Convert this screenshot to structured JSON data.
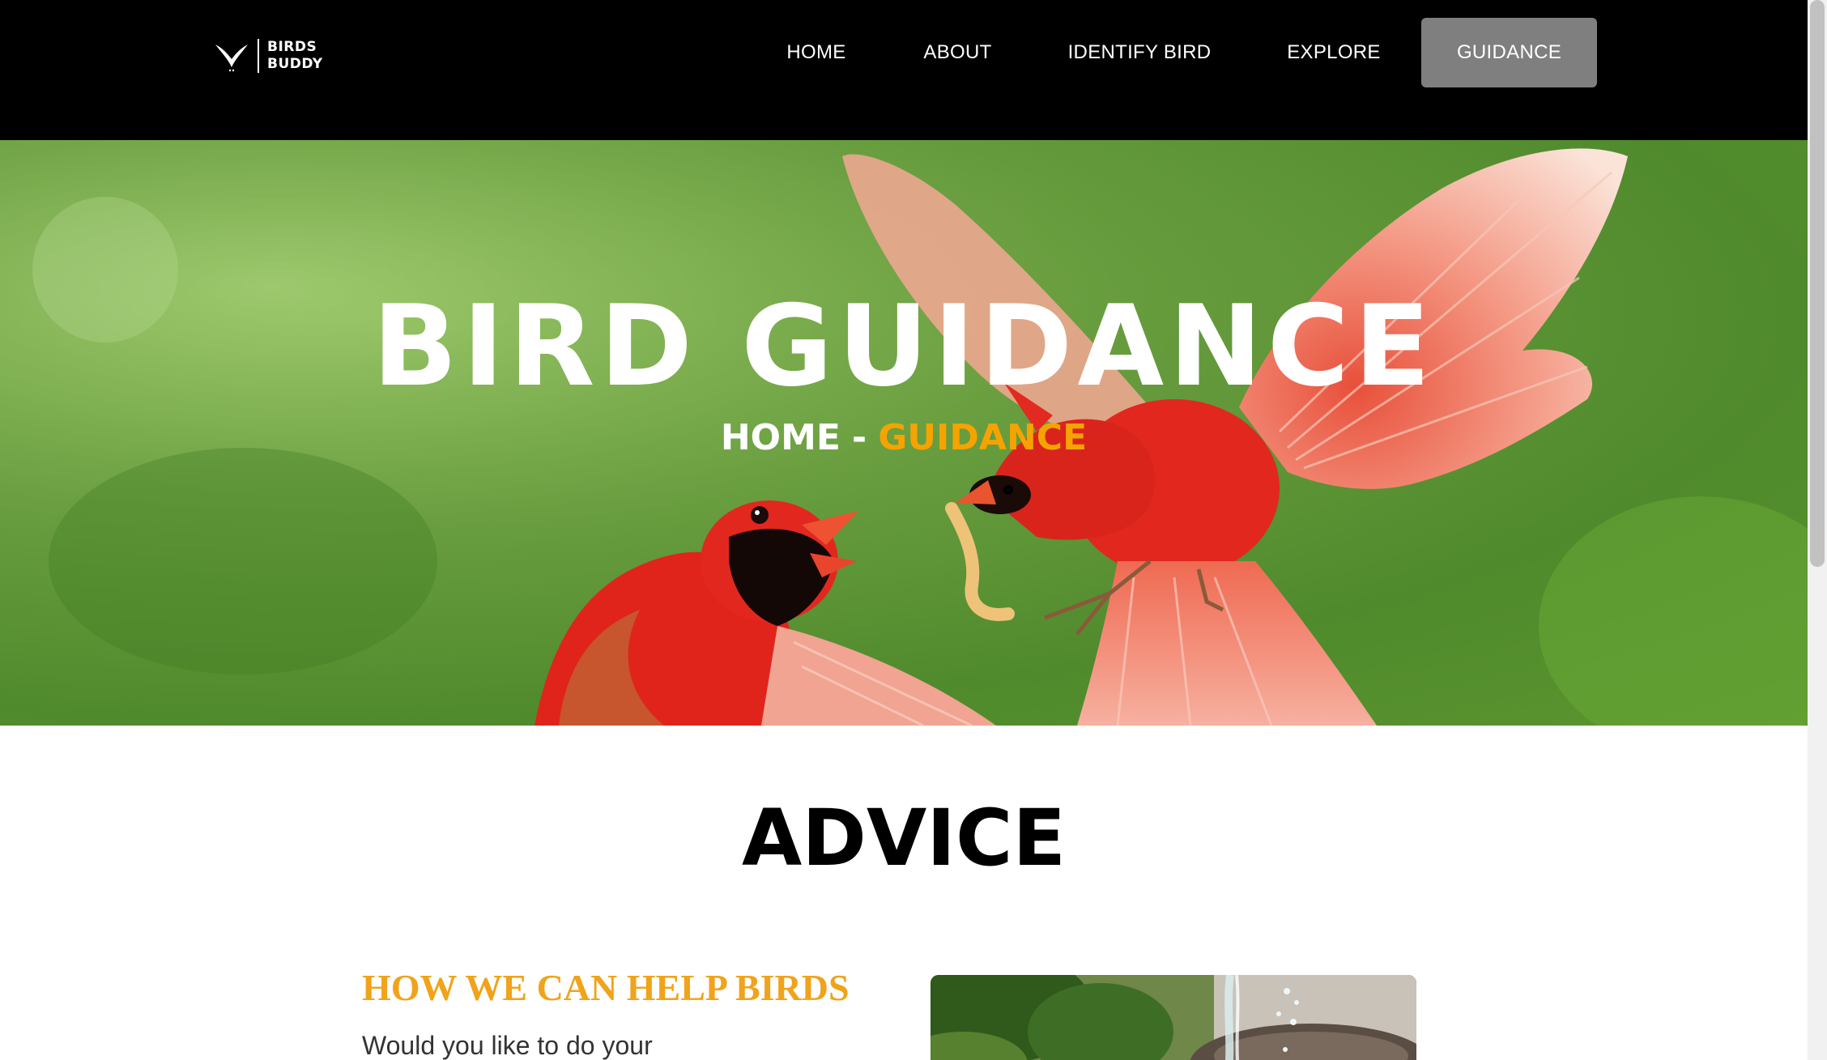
{
  "brand": {
    "line1": "BIRDS",
    "line2": "BUDDY",
    "icon": "bird-logo-icon"
  },
  "nav": {
    "home": "HOME",
    "about": "ABOUT",
    "identify": "IDENTIFY BIRD",
    "explore": "EXPLORE",
    "guidance": "GUIDANCE",
    "active": "GUIDANCE",
    "active_bg": "#7f7f7f"
  },
  "hero": {
    "title": "BIRD GUIDANCE",
    "breadcrumb": {
      "home": "HOME",
      "separator": "-",
      "current": "GUIDANCE"
    },
    "accent_color": "#f5a300",
    "image": "two-red-cardinals-in-flight"
  },
  "advice": {
    "heading": "ADVICE",
    "help_title": "HOW WE CAN HELP BIRDS",
    "help_text": "Would you like to do your",
    "help_title_color": "#f0a31b",
    "image": "bird-bath-water-splash"
  }
}
